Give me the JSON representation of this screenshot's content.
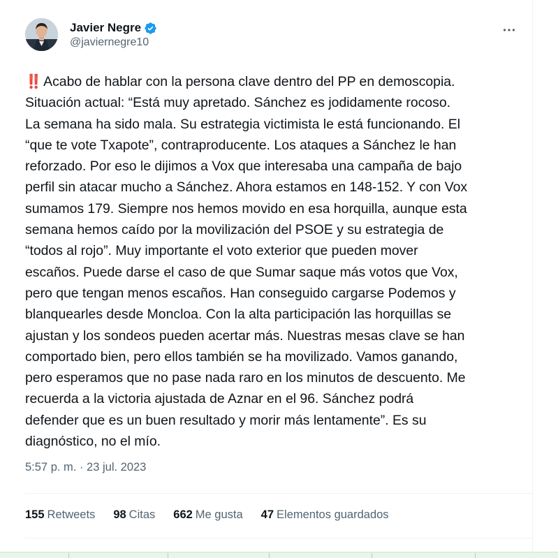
{
  "author": {
    "display_name": "Javier Negre",
    "handle": "@javiernegre10",
    "avatar_icon": "avatar-photo",
    "verified_icon": "verified-badge-icon",
    "verified_color": "#1d9bf0"
  },
  "more_icon": "more-options-icon",
  "tweet": {
    "alert_glyph": "‼️",
    "text": "Acabo de hablar con la persona clave dentro del PP en demoscopia.\nSituación actual: “Está muy apretado. Sánchez es jodidamente rocoso.\nLa semana ha sido mala. Su estrategia victimista le está funcionando. El\n“que te vote Txapote”, contraproducente. Los ataques a Sánchez le han\nreforzado. Por eso le dijimos a Vox que interesaba una campaña de bajo\nperfil sin atacar mucho a Sánchez. Ahora estamos en 148-152. Y con Vox\nsumamos 179. Siempre nos hemos movido en esa horquilla, aunque esta\nsemana hemos caído por la movilización del PSOE y su estrategia de\n“todos al rojo”. Muy importante el voto exterior que pueden mover\nescaños. Puede darse el caso de que Sumar saque más votos que Vox,\npero que tengan menos escaños. Han conseguido cargarse Podemos y\nblanquearles desde Moncloa. Con la alta participación las horquillas se\najustan y los sondeos pueden acertar más. Nuestras mesas clave se han\ncomportado bien, pero ellos también se ha movilizado. Vamos ganando,\npero esperamos que no pase nada raro en los minutos de descuento. Me\nrecuerda a la victoria ajustada de Aznar en el 96. Sánchez podrá\ndefender que es un buen resultado y morir más lentamente”. Es su\ndiagnóstico, no el mío.",
    "timestamp": "5:57 p. m. · 23 jul. 2023"
  },
  "stats": {
    "retweets": {
      "count": "155",
      "label": "Retweets"
    },
    "quotes": {
      "count": "98",
      "label": "Citas"
    },
    "likes": {
      "count": "662",
      "label": "Me gusta"
    },
    "bookmarks": {
      "count": "47",
      "label": "Elementos guardados"
    }
  }
}
